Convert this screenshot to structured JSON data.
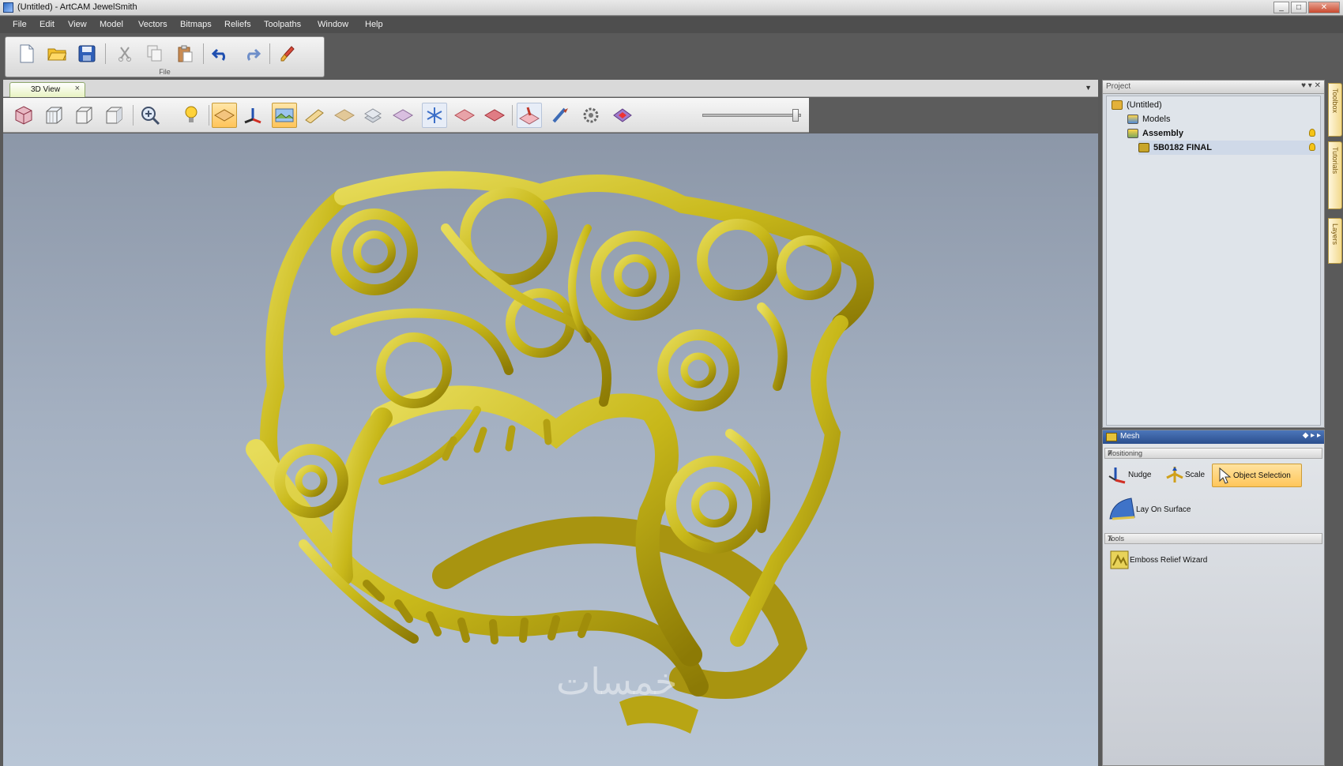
{
  "window": {
    "title": "(Untitled) - ArtCAM JewelSmith"
  },
  "menu": [
    "File",
    "Edit",
    "View",
    "Model",
    "Vectors",
    "Bitmaps",
    "Reliefs",
    "Toolpaths",
    "Window",
    "Help"
  ],
  "ribbon": {
    "group_label": "File"
  },
  "document_tab": {
    "label": "3D View"
  },
  "project_panel": {
    "title": "Project",
    "tree": [
      {
        "label": "(Untitled)"
      },
      {
        "label": "Models"
      },
      {
        "label": "Assembly"
      },
      {
        "label": "5B0182 FINAL"
      }
    ]
  },
  "side_tabs": [
    "Toolbox",
    "Tutorials",
    "Layers"
  ],
  "mesh_panel": {
    "title": "Mesh",
    "positioning_label": "Positioning",
    "positioning_tools": [
      {
        "label": "Nudge"
      },
      {
        "label": "Scale"
      },
      {
        "label": "Object Selection"
      }
    ],
    "lay_on_surface": "Lay On Surface",
    "tools_label": "Tools",
    "emboss": "Emboss Relief Wizard"
  },
  "watermark": "خمسات",
  "colors": {
    "model_gold": "#c8b81a",
    "accent_orange": "#ffc65a",
    "mesh_header": "#2b4f8e"
  }
}
